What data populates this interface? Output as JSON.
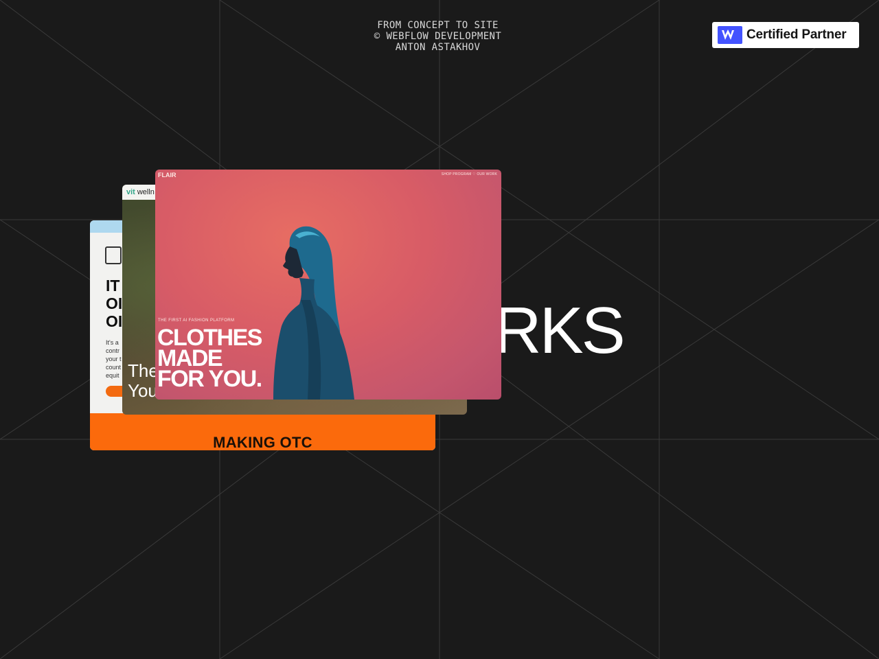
{
  "header": {
    "caption_lines": [
      "FROM CONCEPT TO SITE",
      "© WEBFLOW DEVELOPMENT",
      "ANTON ASTAKHOV"
    ]
  },
  "badge": {
    "label": "Certified Partner",
    "logo_icon": "webflow-w-icon",
    "logo_color": "#4353ff"
  },
  "hero": {
    "title": "WORKS"
  },
  "cards": {
    "back": {
      "headline_lines": [
        "IT",
        "OI",
        "OI"
      ],
      "paragraph_lines": [
        "It's a",
        "contr",
        "your t",
        "count",
        "equit"
      ],
      "footer_text": "MAKING OTC",
      "accent_color": "#fb6a0c"
    },
    "middle": {
      "logo_mark": "vit",
      "logo_text": "welln",
      "overlay_lines": [
        "The",
        "You"
      ]
    },
    "front": {
      "brand": "FLAIR",
      "nav_text": "SHOP  PROGRAM  ♡  OUR WORK",
      "tagline": "THE FIRST AI FASHION PLATFORM",
      "headline_lines": [
        "CLOTHES",
        "MADE",
        "FOR YOU."
      ],
      "bg_color": "#d85c66"
    }
  }
}
